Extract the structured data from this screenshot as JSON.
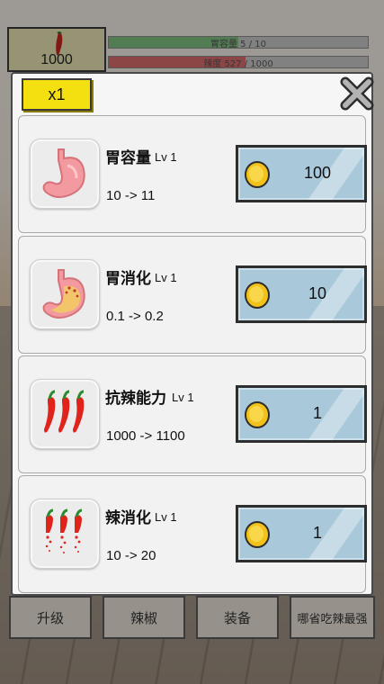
{
  "hud": {
    "coins": "1000",
    "stomach_bar": "胃容量 5 / 10",
    "stomach_fill": 0.5,
    "spicy_bar": "辣度 527 / 1000",
    "spicy_fill": 0.527
  },
  "bottom_nav": [
    "升级",
    "辣椒",
    "装备",
    "哪省吃辣最强"
  ],
  "dialog": {
    "multiplier": "x1",
    "upgrades": [
      {
        "name": "胃容量",
        "level": "Lv 1",
        "change": "10 -> 11",
        "price": "100",
        "icon": "stomach-icon"
      },
      {
        "name": "胃消化",
        "level": "Lv 1",
        "change": "0.1 -> 0.2",
        "price": "10",
        "icon": "digesting-stomach-icon"
      },
      {
        "name": "抗辣能力",
        "level": "Lv 1",
        "change": "1000 -> 1100",
        "price": "1",
        "icon": "chili-peppers-icon"
      },
      {
        "name": "辣消化",
        "level": "Lv 1",
        "change": "10 -> 20",
        "price": "1",
        "icon": "dissolving-chili-icon"
      }
    ]
  },
  "colors": {
    "multiplier_button": "#f4e011",
    "buy_button": "#a9c9db",
    "coin": "#f2c21a"
  }
}
